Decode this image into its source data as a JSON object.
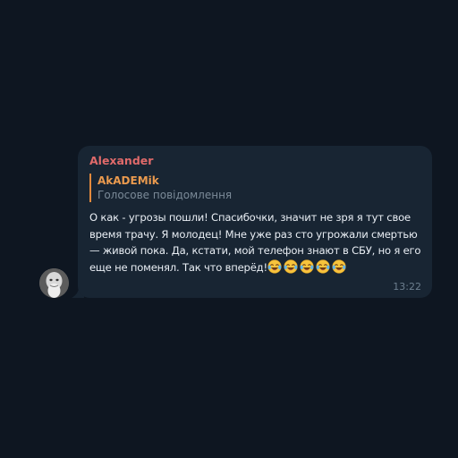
{
  "message": {
    "sender": "Alexander",
    "reply": {
      "author": "AkADEMik",
      "text": "Голосове повідомлення"
    },
    "text": "О как - угрозы пошли! Спасибочки, значит не зря я тут свое время трачу. Я молодец! Мне уже раз сто угрожали смертью — живой пока. Да, кстати, мой телефон знают в СБУ, но я его еще не поменял. Так что вперёд!",
    "emojis": [
      "😂",
      "😂",
      "😂",
      "😂",
      "😂"
    ],
    "time": "13:22"
  },
  "colors": {
    "background": "#0e1621",
    "bubble": "#182533",
    "sender": "#e06a6a",
    "reply_accent": "#e38a3d",
    "text": "#e9eef4",
    "muted": "#6d7f8f"
  },
  "icons": {
    "emoji": "face-with-tears-of-joy-icon",
    "avatar": "user-avatar"
  }
}
